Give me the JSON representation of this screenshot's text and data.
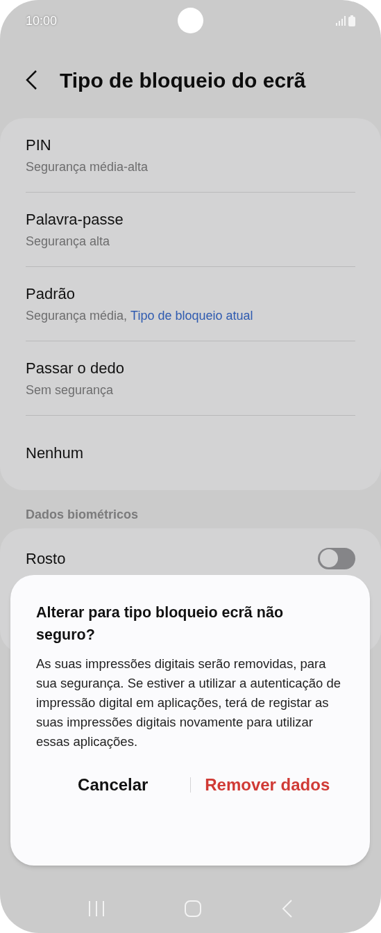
{
  "status_bar": {
    "time": "10:00"
  },
  "header": {
    "title": "Tipo de bloqueio do ecrã"
  },
  "lock_types": [
    {
      "title": "PIN",
      "subtitle": "Segurança média-alta"
    },
    {
      "title": "Palavra-passe",
      "subtitle": "Segurança alta"
    },
    {
      "title": "Padrão",
      "subtitle": "Segurança média,",
      "status": "Tipo de bloqueio atual"
    },
    {
      "title": "Passar o dedo",
      "subtitle": "Sem segurança"
    },
    {
      "title": "Nenhum"
    }
  ],
  "biometrics": {
    "heading": "Dados biométricos",
    "items": [
      {
        "title": "Rosto",
        "on": false
      }
    ]
  },
  "dialog": {
    "title": "Alterar para tipo bloqueio ecrã não seguro?",
    "body": "As suas impressões digitais serão removidas, para sua segurança. Se estiver a utilizar a autenticação de impressão digital em aplicações, terá de registar as suas impressões digitais novamente para utilizar essas aplicações.",
    "buttons": [
      {
        "label": "Cancelar",
        "kind": "neutral"
      },
      {
        "label": "Remover dados",
        "kind": "destructive"
      }
    ]
  }
}
